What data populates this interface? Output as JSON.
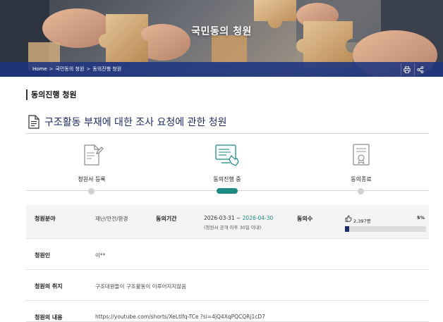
{
  "hero": {
    "title": "국민동의 청원"
  },
  "breadcrumb": {
    "home": "Home",
    "item1": "국민동의 청원",
    "item2": "동의진행 청원",
    "separator": ">"
  },
  "actions": {
    "print_icon": "printer-icon",
    "share_icon": "share-icon"
  },
  "section": {
    "title": "동의진행 청원"
  },
  "petition": {
    "title": "구조활동 부재에 대한 조사 요청에 관한 청원"
  },
  "steps": [
    {
      "label": "청원서 등록",
      "icon": "document-pen-icon",
      "active": false
    },
    {
      "label": "동의진행 중",
      "icon": "monitor-hand-icon",
      "active": true
    },
    {
      "label": "동의종료",
      "icon": "certificate-icon",
      "active": false
    }
  ],
  "info": {
    "category_label": "청원분야",
    "category_value": "재난/안전/환경",
    "period_label": "동의기간",
    "period_start": "2026-03-31",
    "period_tilde": " ~ ",
    "period_end": "2026-04-30",
    "period_note": "(청원서 공개 이후 30일 이내)",
    "agree_label": "동의수",
    "agree_count": "2,397명",
    "agree_percent": "5%",
    "agree_fraction": 0.05,
    "petitioner_label": "청원인",
    "petitioner_value": "이**",
    "purpose_label": "청원의 취지",
    "purpose_value": "구조대원들이 구조활동이 이루어지지않음",
    "content_label": "청원의 내용",
    "content_value": "https://youtube.com/shorts/XeLtIfq-TCe ?si=4jQ4XqPQCQRj1cD7"
  },
  "colors": {
    "accent_teal": "#1f8a84",
    "navy": "#1d2d6b",
    "crumb_bar": "#1e3480"
  }
}
